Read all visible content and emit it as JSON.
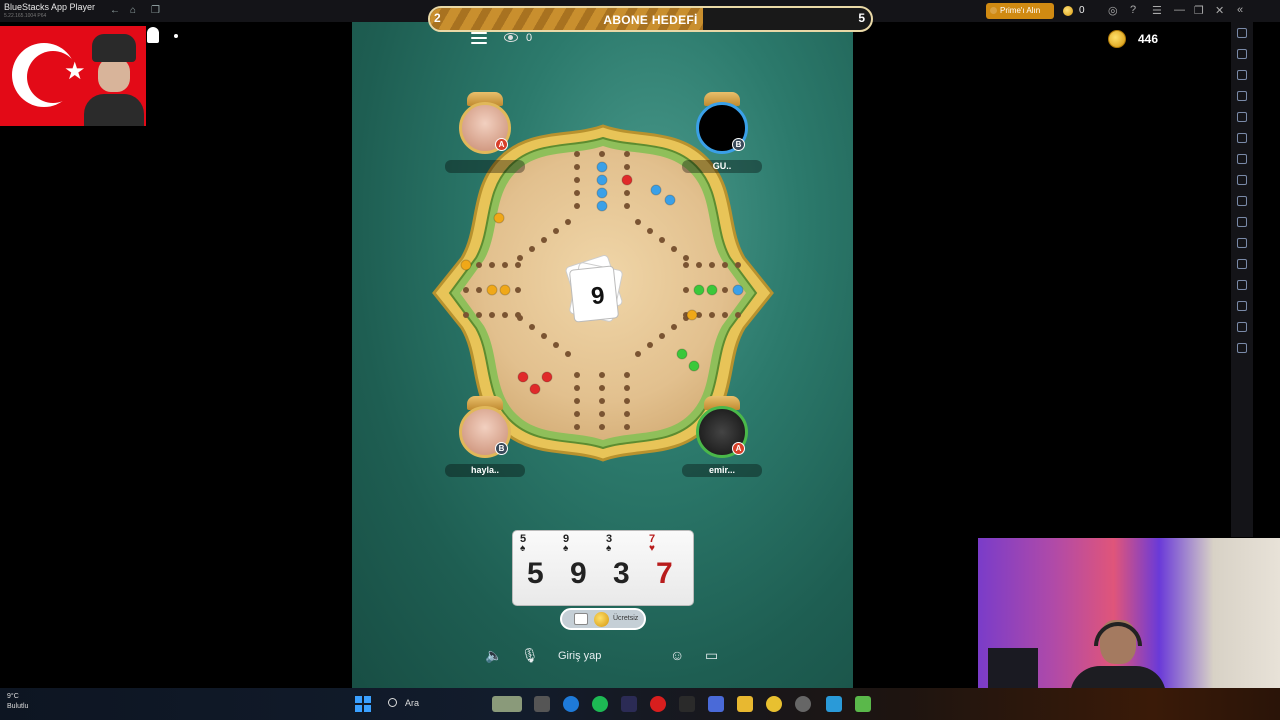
{
  "window": {
    "app_title": "BlueStacks App Player",
    "app_version": "5.22.165.1004 P64",
    "prime_button": "Prime'ı Alın",
    "coin_count": "0"
  },
  "stream": {
    "goal_left": "2",
    "goal_title": "ABONE HEDEFİ",
    "goal_right": "5",
    "goal_progress": 0.62
  },
  "game": {
    "viewer_count": "0",
    "coins": "446",
    "center_card": "9",
    "players": [
      {
        "name": "",
        "badge": "A",
        "badge_color": "#d8402a",
        "ring": "#e1b85a",
        "position": "top-left"
      },
      {
        "name": "GU..",
        "badge": "B",
        "badge_color": "#3a4a5a",
        "ring": "#3aa0e8",
        "position": "top-right"
      },
      {
        "name": "hayla..",
        "badge": "B",
        "badge_color": "#3a4a5a",
        "ring": "#e1b85a",
        "position": "bottom-left"
      },
      {
        "name": "emir...",
        "badge": "A",
        "badge_color": "#d8402a",
        "ring": "#4ab84a",
        "position": "bottom-right"
      }
    ],
    "hand": [
      {
        "rank": "5",
        "suit": "♠",
        "color": "#222"
      },
      {
        "rank": "9",
        "suit": "♠",
        "color": "#222"
      },
      {
        "rank": "3",
        "suit": "♠",
        "color": "#222"
      },
      {
        "rank": "7",
        "suit": "♥",
        "color": "#b81c1c"
      }
    ],
    "free_label": "Ücretsiz",
    "login_label": "Giriş yap"
  },
  "taskbar": {
    "weather_temp": "9°C",
    "weather_desc": "Bulutlu",
    "search_label": "Ara"
  },
  "colors": {
    "table_green": "#2c7a6c",
    "board_wood": "#e2c08e",
    "board_rim": "#8fbf5a"
  }
}
